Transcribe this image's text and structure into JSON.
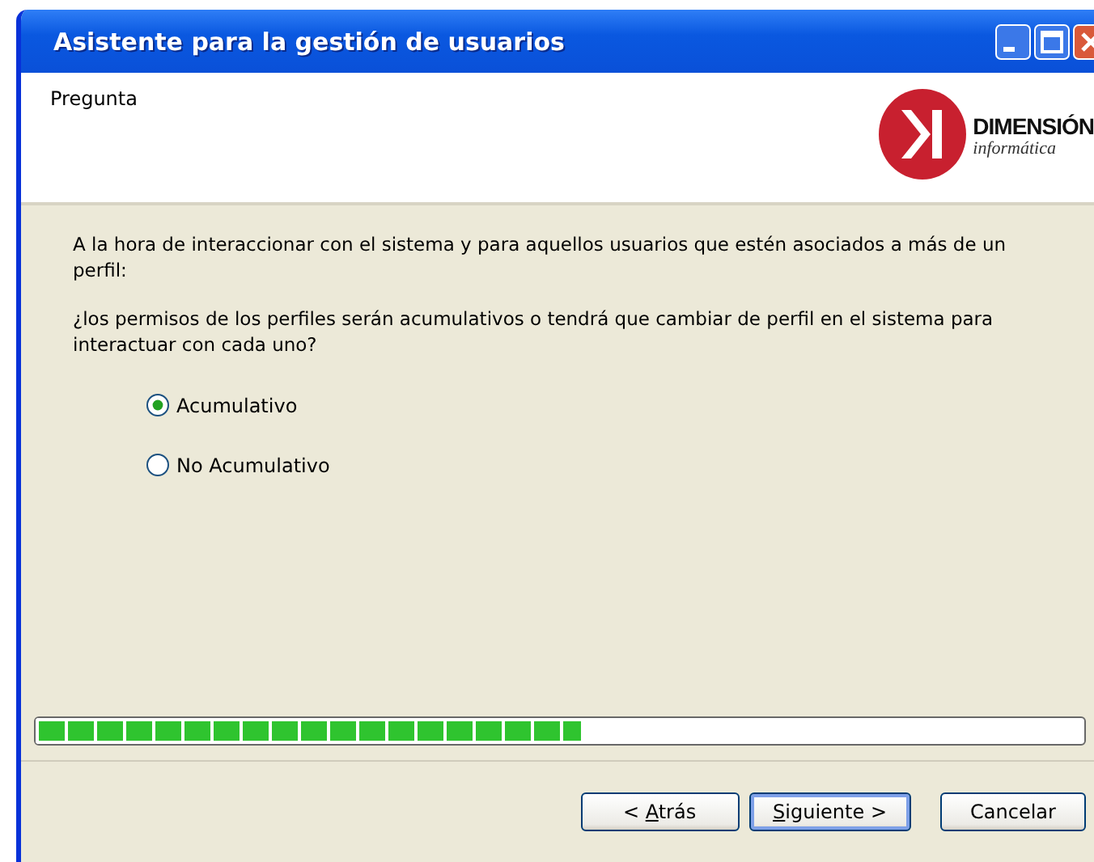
{
  "window": {
    "title": "Asistente para la gestión de usuarios"
  },
  "header": {
    "step": "Pregunta",
    "logo": {
      "name": "DIMENSIÓN",
      "subtitle": "informática"
    }
  },
  "question": {
    "intro": "A la hora de interaccionar con el sistema y para aquellos usuarios que estén asociados a más de un perfil:",
    "text": "¿los permisos de los perfiles serán acumulativos o tendrá que cambiar de perfil en el sistema para interactuar con cada uno?"
  },
  "options": [
    {
      "label": "Acumulativo",
      "selected": true
    },
    {
      "label": "No Acumulativo",
      "selected": false
    }
  ],
  "progress": {
    "level": 0.52
  },
  "buttons": [
    {
      "prefix": "< ",
      "access_key": "A",
      "rest": "trás",
      "default": false
    },
    {
      "access_key": "S",
      "rest": "iguiente >",
      "default": true
    },
    {
      "rest": "Cancelar",
      "default": false
    }
  ]
}
